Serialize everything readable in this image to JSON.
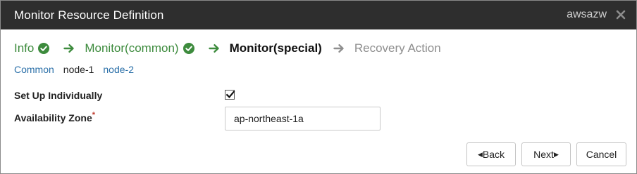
{
  "window": {
    "title": "Monitor Resource Definition",
    "host": "awsazw",
    "close_icon": "close-x-icon"
  },
  "steps": [
    {
      "label": "Info",
      "state": "done"
    },
    {
      "label": "Monitor(common)",
      "state": "done"
    },
    {
      "label": "Monitor(special)",
      "state": "current"
    },
    {
      "label": "Recovery Action",
      "state": "pending"
    }
  ],
  "node_tabs": [
    {
      "label": "Common",
      "active": false
    },
    {
      "label": "node-1",
      "active": true
    },
    {
      "label": "node-2",
      "active": false
    }
  ],
  "form": {
    "setup_individually": {
      "label": "Set Up Individually",
      "checked": true
    },
    "availability_zone": {
      "label": "Availability Zone",
      "required_mark": "*",
      "value": "ap-northeast-1a"
    }
  },
  "buttons": {
    "back": "Back",
    "next": "Next",
    "cancel": "Cancel"
  },
  "colors": {
    "titlebar": "#2e2e2e",
    "step_done": "#3d8b3d",
    "link": "#2a6fa8",
    "required": "#c0392b"
  }
}
